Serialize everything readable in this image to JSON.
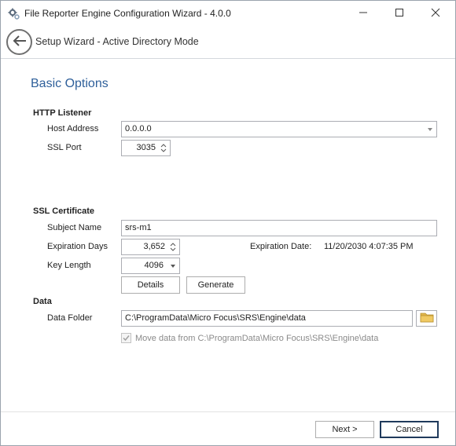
{
  "window": {
    "title": "File Reporter Engine Configuration Wizard - 4.0.0",
    "minimize_glyph": "—",
    "maximize_glyph": "☐",
    "close_glyph": "✕"
  },
  "header": {
    "subtitle": "Setup Wizard - Active Directory Mode"
  },
  "page": {
    "title": "Basic Options"
  },
  "http_listener": {
    "section_label": "HTTP Listener",
    "host_address_label": "Host Address",
    "host_address_value": "0.0.0.0",
    "ssl_port_label": "SSL Port",
    "ssl_port_value": "3035"
  },
  "ssl_certificate": {
    "section_label": "SSL Certificate",
    "subject_name_label": "Subject Name",
    "subject_name_value": "srs-m1",
    "expiration_days_label": "Expiration Days",
    "expiration_days_value": "3,652",
    "expiration_date_label": "Expiration Date:",
    "expiration_date_value": "11/20/2030 4:07:35 PM",
    "key_length_label": "Key Length",
    "key_length_value": "4096",
    "details_button": "Details",
    "generate_button": "Generate"
  },
  "data": {
    "section_label": "Data",
    "data_folder_label": "Data Folder",
    "data_folder_value": "C:\\ProgramData\\Micro Focus\\SRS\\Engine\\data",
    "move_data_label": "Move data from C:\\ProgramData\\Micro Focus\\SRS\\Engine\\data",
    "move_data_checked": true
  },
  "footer": {
    "next_button": "Next >",
    "cancel_button": "Cancel"
  },
  "icons": {
    "app": "gear-icon",
    "back": "back-arrow-icon",
    "folder": "folder-icon",
    "dropdown": "chevron-down-icon",
    "spinner": "spinner-arrows-icon"
  },
  "colors": {
    "page_title": "#2e5f9a",
    "cancel_border": "#1f3a5c",
    "folder": "#e0b64c"
  }
}
